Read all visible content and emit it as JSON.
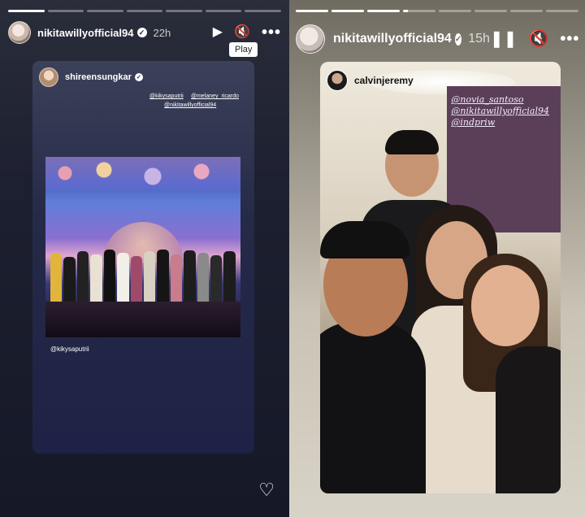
{
  "left_story": {
    "progress": [
      1,
      0,
      0,
      0,
      0,
      0,
      0
    ],
    "header": {
      "username": "nikitawillyofficial94",
      "time": "22h",
      "verified_glyph": "✓",
      "play_icon": "▶",
      "mute_icon": "🔇",
      "more_icon": "•••"
    },
    "tooltip": "Play",
    "repost": {
      "username": "shireensungkar",
      "mentions": [
        "@kikysaputrii",
        "@melaney_ricardo",
        "@nikitawillyofficial94"
      ],
      "bottom_tag": "@kikysaputrii"
    },
    "heart_icon": "♡"
  },
  "right_story": {
    "progress": [
      1,
      1,
      1,
      0.15,
      0,
      0,
      0,
      0
    ],
    "header": {
      "username": "nikitawillyofficial94",
      "time": "15h",
      "verified_glyph": "✓",
      "pause_icon": "❚❚",
      "mute_icon": "🔇",
      "more_icon": "•••"
    },
    "photo": {
      "username": "calvinjeremy",
      "handwritten_tags": [
        "@novia_santoso",
        "@nikitawillyofficial94",
        "@indpriw"
      ]
    }
  },
  "colors": {
    "left_bg": "#1d2030",
    "card_bg": "#252a48",
    "right_bg": "#c9c3b5",
    "wall": "#5b3f58"
  }
}
